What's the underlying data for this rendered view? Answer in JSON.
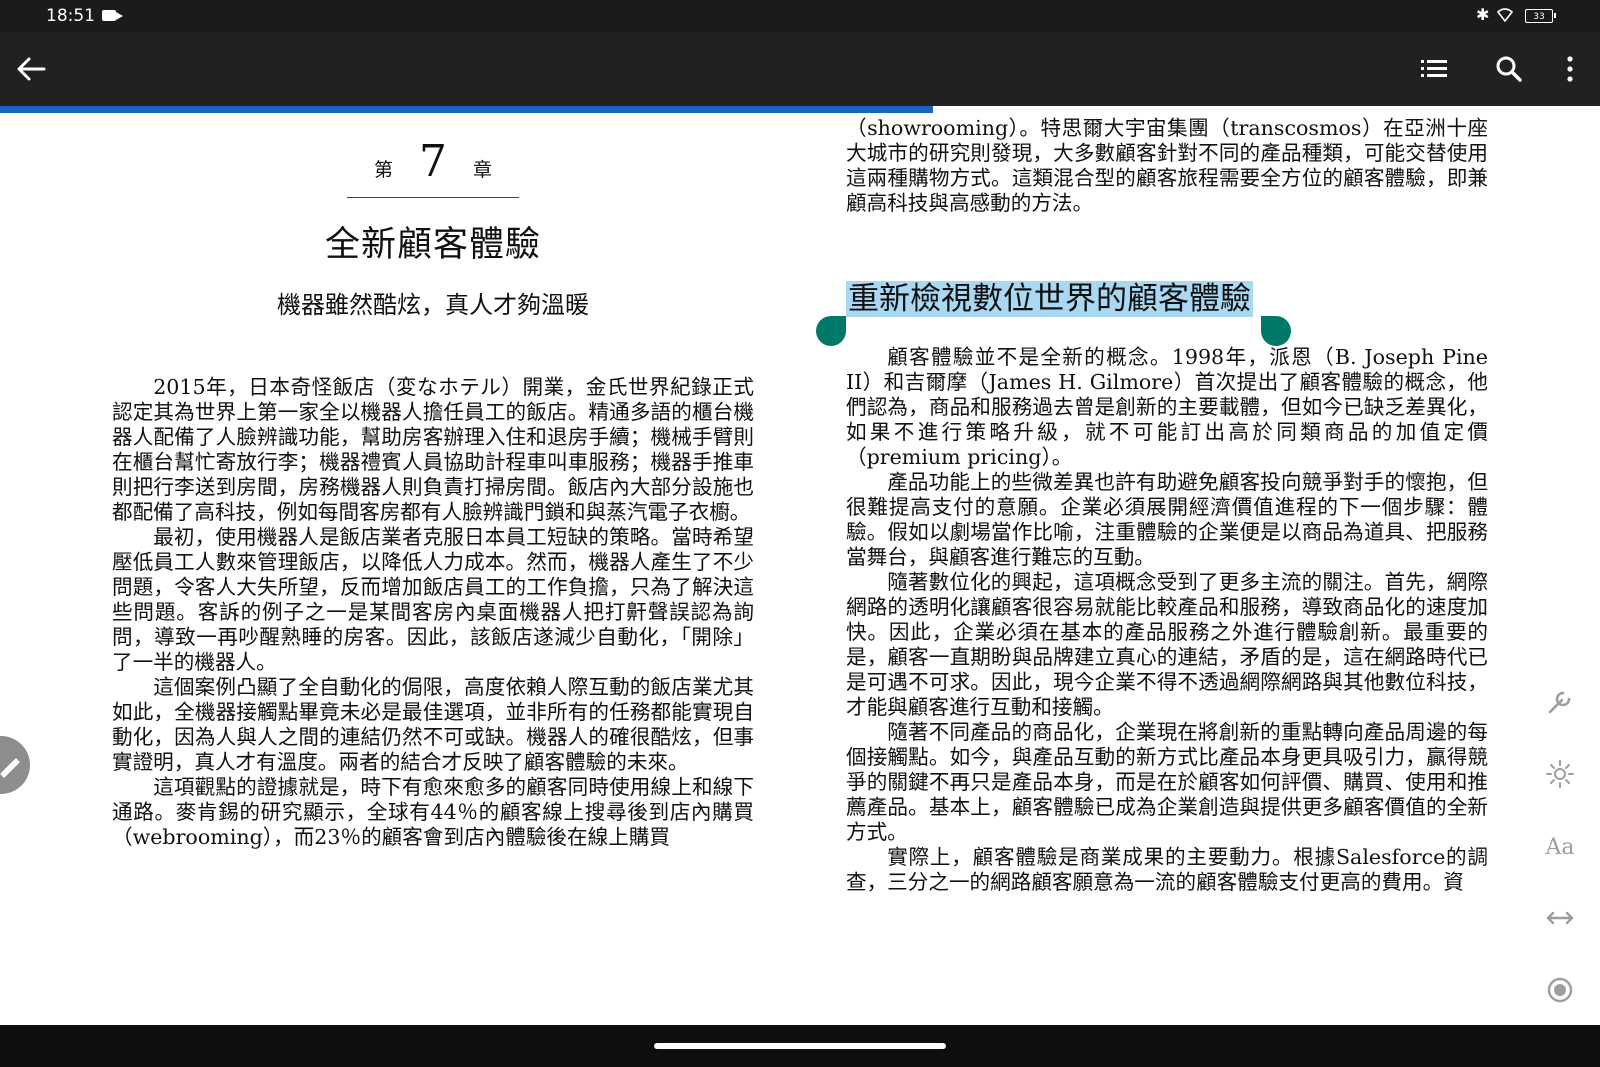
{
  "status_bar": {
    "time": "18:51",
    "battery": "33"
  },
  "reading_progress": 0.583,
  "chapter": {
    "prefix": "第",
    "number": "7",
    "suffix": "章",
    "title": "全新顧客體驗",
    "subtitle": "機器雖然酷炫，真人才夠溫暖"
  },
  "left_page_paragraphs": [
    "2015年，日本奇怪飯店（変なホテル）開業，金氏世界紀錄正式認定其為世界上第一家全以機器人擔任員工的飯店。精通多語的櫃台機器人配備了人臉辨識功能，幫助房客辦理入住和退房手續；機械手臂則在櫃台幫忙寄放行李；機器禮賓人員協助計程車叫車服務；機器手推車則把行李送到房間，房務機器人則負責打掃房間。飯店內大部分設施也都配備了高科技，例如每間客房都有人臉辨識門鎖和與蒸汽電子衣櫥。",
    "最初，使用機器人是飯店業者克服日本員工短缺的策略。當時希望壓低員工人數來管理飯店，以降低人力成本。然而，機器人產生了不少問題，令客人大失所望，反而增加飯店員工的工作負擔，只為了解決這些問題。客訴的例子之一是某間客房內桌面機器人把打鼾聲誤認為詢問，導致一再吵醒熟睡的房客。因此，該飯店遂減少自動化，「開除」了一半的機器人。",
    "這個案例凸顯了全自動化的侷限，高度依賴人際互動的飯店業尤其如此，全機器接觸點畢竟未必是最佳選項，並非所有的任務都能實現自動化，因為人與人之間的連結仍然不可或缺。機器人的確很酷炫，但事實證明，真人才有溫度。兩者的結合才反映了顧客體驗的未來。",
    "這項觀點的證據就是，時下有愈來愈多的顧客同時使用線上和線下通路。麥肯錫的研究顯示，全球有44％的顧客線上搜尋後到店內購買（webrooming），而23％的顧客會到店內體驗後在線上購買"
  ],
  "right_page_top_paragraph": "（showrooming）。特思爾大宇宙集團（transcosmos）在亞洲十座大城市的研究則發現，大多數顧客針對不同的產品種類，可能交替使用這兩種購物方式。這類混合型的顧客旅程需要全方位的顧客體驗，即兼顧高科技與高感動的方法。",
  "section_title": "重新檢視數位世界的顧客體驗",
  "right_page_paragraphs": [
    "顧客體驗並不是全新的概念。1998年，派恩（B. Joseph Pine II）和吉爾摩（James H. Gilmore）首次提出了顧客體驗的概念，他們認為，商品和服務過去曾是創新的主要載體，但如今已缺乏差異化，如果不進行策略升級，就不可能訂出高於同類商品的加值定價（premium pricing）。",
    "產品功能上的些微差異也許有助避免顧客投向競爭對手的懷抱，但很難提高支付的意願。企業必須展開經濟價值進程的下一個步驟：體驗。假如以劇場當作比喻，注重體驗的企業便是以商品為道具、把服務當舞台，與顧客進行難忘的互動。",
    "隨著數位化的興起，這項概念受到了更多主流的關注。首先，網際網路的透明化讓顧客很容易就能比較產品和服務，導致商品化的速度加快。因此，企業必須在基本的產品服務之外進行體驗創新。最重要的是，顧客一直期盼與品牌建立真心的連結，矛盾的是，這在網路時代已是可遇不可求。因此，現今企業不得不透過網際網路與其他數位科技，才能與顧客進行互動和接觸。",
    "隨著不同產品的商品化，企業現在將創新的重點轉向產品周邊的每個接觸點。如今，與產品互動的新方式比產品本身更具吸引力，贏得競爭的關鍵不再只是產品本身，而是在於顧客如何評價、購買、使用和推薦產品。基本上，顧客體驗已成為企業創造與提供更多顧客價值的全新方式。",
    "實際上，顧客體驗是商業成果的主要動力。根據Salesforce的調查，三分之一的網路顧客願意為一流的顧客體驗支付更高的費用。資"
  ],
  "side_tools": {
    "text_size_label": "Aa"
  },
  "icons": {
    "back": "arrow-left-icon",
    "toc": "list-icon",
    "search": "search-icon",
    "more": "more-vert-icon",
    "settings": "wrench-icon",
    "brightness": "brightness-icon",
    "text_size": "text-size-icon",
    "page_width": "horizontal-arrows-icon",
    "auto_scroll": "radio-button-icon",
    "annotate": "pencil-icon"
  },
  "colors": {
    "toolbar": "#212121",
    "progress": "#1565c0",
    "highlight": "#a9d8f3",
    "selection_handle": "#00796b"
  }
}
